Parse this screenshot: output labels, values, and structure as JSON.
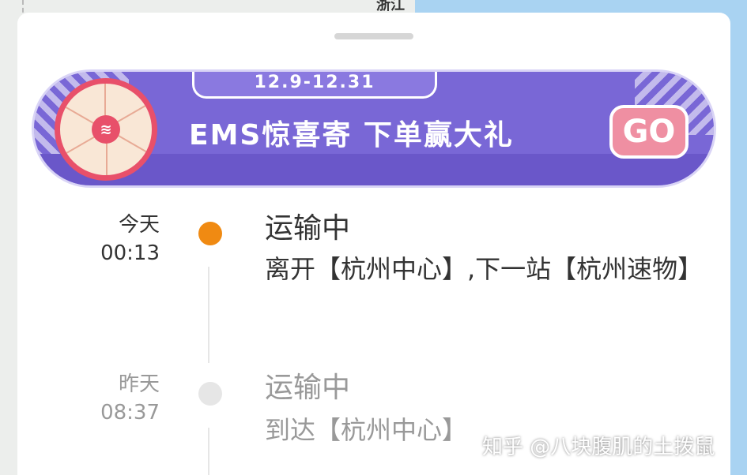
{
  "map": {
    "label": "浙江"
  },
  "banner": {
    "date_range": "12.9-12.31",
    "headline": "EMS惊喜寄 下单赢大礼",
    "go_label": "GO",
    "colors": {
      "background": "#7967d6",
      "accent": "#e8506a",
      "go": "#ef8fa2"
    }
  },
  "timeline": [
    {
      "day": "今天",
      "time": "00:13",
      "status": "运输中",
      "detail": "离开【杭州中心】,下一站【杭州速物】",
      "dot_color": "#f08a12",
      "current": true
    },
    {
      "day": "昨天",
      "time": "08:37",
      "status": "运输中",
      "detail": "到达【杭州中心】",
      "dot_color": "#e6e6e6",
      "current": false
    }
  ],
  "watermark": "知乎 @八块腹肌的土拨鼠"
}
